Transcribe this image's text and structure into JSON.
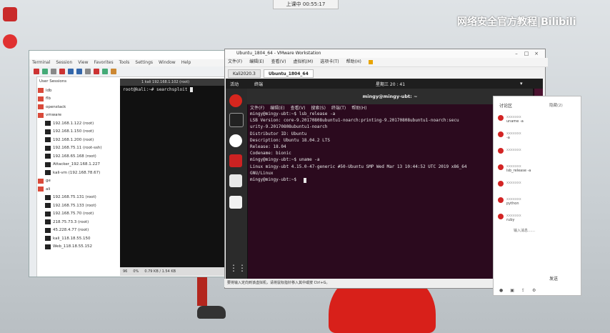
{
  "desktop": {
    "banner": "上课中 00:55:17",
    "watermark": "网络安全官方教程|Bilibili",
    "icons": [
      "app-icon-red",
      "app-icon-red-2",
      "app-icon-small"
    ]
  },
  "xshell": {
    "menu": [
      "Terminal",
      "Session",
      "View",
      "Favorites",
      "Tools",
      "Settings",
      "Window",
      "Help"
    ],
    "tree_header": "User Sessions",
    "tree": [
      {
        "label": "ldb",
        "type": "folder"
      },
      {
        "label": "flb",
        "type": "folder"
      },
      {
        "label": "openstack",
        "type": "folder"
      },
      {
        "label": "vmware",
        "type": "folder"
      },
      {
        "label": "192.168.1.122 (root)",
        "type": "session"
      },
      {
        "label": "192.168.1.150 (root)",
        "type": "session"
      },
      {
        "label": "192.168.1.200 (root)",
        "type": "session"
      },
      {
        "label": "192.168.75.11 (root-ssh)",
        "type": "session"
      },
      {
        "label": "192.168.65.168 (root)",
        "type": "session"
      },
      {
        "label": "Attacker_192.168.1.227",
        "type": "session"
      },
      {
        "label": "kali-vm (192.168.78.67)",
        "type": "session"
      },
      {
        "label": "ge",
        "type": "folder"
      },
      {
        "label": "ali",
        "type": "folder"
      },
      {
        "label": "192.168.75.131 (root)",
        "type": "session"
      },
      {
        "label": "192.168.75.133 (root)",
        "type": "session"
      },
      {
        "label": "192.168.75.70 (root)",
        "type": "session"
      },
      {
        "label": "218.75.73.3 (root)",
        "type": "session"
      },
      {
        "label": "45.228.4.77 (root)",
        "type": "session"
      },
      {
        "label": "kali_118.18.55.150",
        "type": "session"
      },
      {
        "label": "Web_118.18.55.152",
        "type": "session"
      }
    ],
    "terminal_tab": "1 kali 192.168.1.102 (root)",
    "prompt": "root@kali:~# searchsploit ",
    "status": [
      "96",
      "0%",
      "0.79 KB / 1.54 KB"
    ]
  },
  "vmware": {
    "title": "Ubuntu_1804_64 - VMware Workstation",
    "menu": [
      "文件(F)",
      "编辑(E)",
      "查看(V)",
      "虚拟机(M)",
      "选项卡(T)",
      "帮助(H)"
    ],
    "tabs": [
      {
        "label": "Kali2020.3",
        "active": false
      },
      {
        "label": "Ubuntu_1804_64",
        "active": true
      }
    ],
    "statusbar": "要将输入定向到该虚拟机，请将鼠标指针移入其中或按 Ctrl+G。"
  },
  "ubuntu": {
    "activities": "活动",
    "app": "终端",
    "clock": "星期三 20 : 41",
    "term_title": "mingy@mingy-ubt: ~",
    "term_menu": [
      "文件(F)",
      "编辑(E)",
      "查看(V)",
      "搜索(S)",
      "终端(T)",
      "帮助(H)"
    ],
    "lines": [
      "mingy@mingy-ubt:~$ lsb_release -a",
      "LSB Version:     core-9.20170808ubuntu1-noarch:printing-9.20170808ubuntu1-noarch:secu",
      "urity-9.20170808ubuntu1-noarch",
      "Distributor ID:  Ubuntu",
      "Description:     Ubuntu 18.04.2 LTS",
      "Release:         18.04",
      "Codename:        bionic",
      "mingy@mingy-ubt:~$ uname -a",
      "Linux mingy-ubt 4.15.0-47-generic #50-Ubuntu SMP Wed Mar 13 10:44:52 UTC 2019 x86_64",
      "GNU/Linux",
      "mingy@mingy-ubt:~$ "
    ]
  },
  "chat": {
    "title": "讨论区",
    "title_right": "隐藏(2)",
    "messages": [
      {
        "name": "xxxxxxx",
        "text": "uname -a"
      },
      {
        "name": "xxxxxxx",
        "text": "-a"
      },
      {
        "name": "xxxxxxx",
        "text": ""
      },
      {
        "name": "xxxxxxx",
        "text": "lsb_release -a"
      },
      {
        "name": "xxxxxxx",
        "text": ""
      },
      {
        "name": "xxxxxxx",
        "text": "python"
      },
      {
        "name": "xxxxxxx",
        "text": "ruby"
      }
    ],
    "input_hint": "输入消息……",
    "send": "发送",
    "bottom_icons": [
      "mic-icon",
      "video-icon",
      "share-icon",
      "settings-icon"
    ]
  }
}
